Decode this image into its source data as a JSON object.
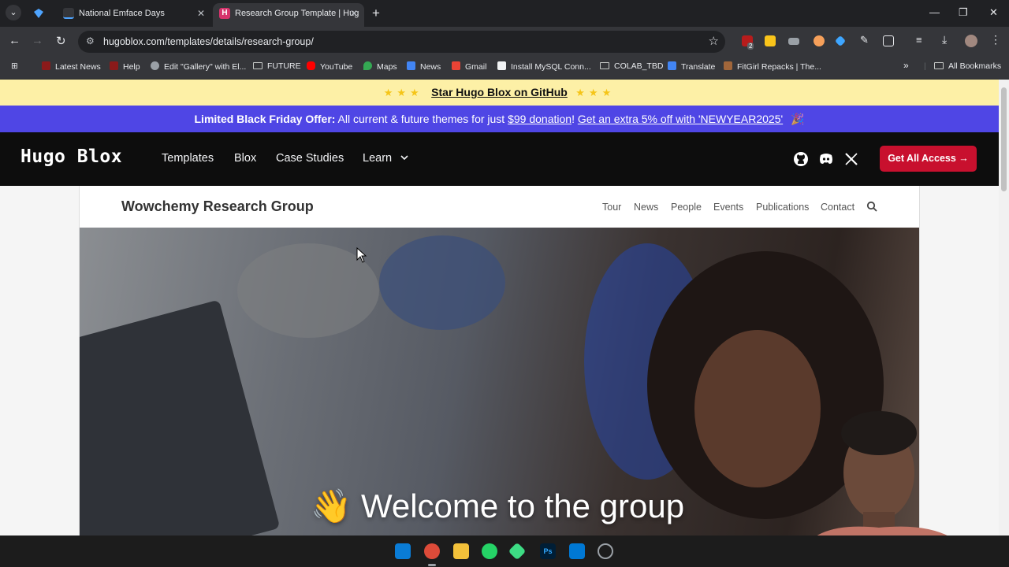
{
  "browser": {
    "tabs": [
      {
        "title": "National Emface Days",
        "active": false
      },
      {
        "title": "Research Group Template | Hug",
        "active": true
      }
    ],
    "url": "hugoblox.com/templates/details/research-group/",
    "extension_badge": "2",
    "bookmarks": [
      "Latest News",
      "Help",
      "Edit \"Gallery\" with El...",
      "FUTURE",
      "YouTube",
      "Maps",
      "News",
      "Gmail",
      "Install MySQL Conn...",
      "COLAB_TBD",
      "Translate",
      "FitGirl Repacks | The..."
    ],
    "all_bookmarks": "All Bookmarks"
  },
  "banner": {
    "github_link": "Star Hugo Blox on GitHub"
  },
  "promo": {
    "bold": "Limited Black Friday Offer:",
    "text": " All current & future themes for just ",
    "price_link": "$99 donation",
    "sep": "! ",
    "code_link": "Get an extra 5% off with 'NEWYEAR2025'"
  },
  "site_nav": {
    "logo": "Hugo Blox",
    "links": [
      "Templates",
      "Blox",
      "Case Studies",
      "Learn"
    ],
    "cta": "Get All Access →"
  },
  "preview": {
    "title": "Wowchemy Research Group",
    "links": [
      "Tour",
      "News",
      "People",
      "Events",
      "Publications",
      "Contact"
    ],
    "hero_title": "👋 Welcome to the group"
  },
  "colors": {
    "promo_bg": "#4f46e5",
    "cta_bg": "#c8102e",
    "banner_bg": "#fdf0a6"
  }
}
